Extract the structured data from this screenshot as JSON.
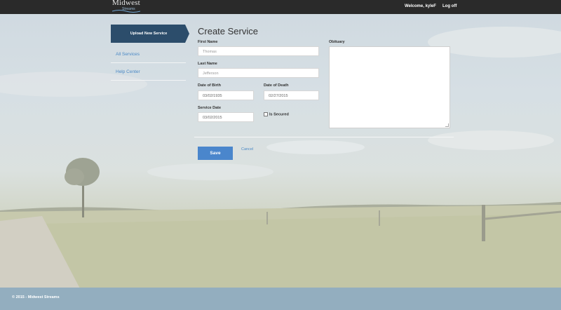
{
  "header": {
    "logo_text": "Midwest",
    "logo_subtext": "Streams",
    "welcome": "Welcome, kyleF",
    "logoff": "Log off"
  },
  "sidebar": {
    "items": [
      {
        "label": "Upload New Service",
        "active": true
      },
      {
        "label": "All Services",
        "active": false
      },
      {
        "label": "Help Center",
        "active": false
      }
    ]
  },
  "form": {
    "title": "Create Service",
    "first_name_label": "First Name",
    "first_name_value": "",
    "first_name_placeholder": "Thomas",
    "last_name_label": "Last Name",
    "last_name_value": "",
    "last_name_placeholder": "Jefferson",
    "dob_label": "Date of Birth",
    "dob_value": "03/02/1935",
    "dod_label": "Date of Death",
    "dod_value": "02/27/2015",
    "service_date_label": "Service Date",
    "service_date_value": "03/02/2015",
    "is_secured_label": "Is Secured",
    "is_secured_checked": false,
    "obituary_label": "Obituary",
    "obituary_value": "",
    "save_label": "Save",
    "cancel_label": "Cancel"
  },
  "footer": {
    "text": "© 2015 - Midwest Streams"
  },
  "colors": {
    "topbar": "#2a2a2a",
    "sidebar_active": "#2c4d6b",
    "link": "#4a88c5",
    "save_button": "#4a86cc",
    "footer": "#93aebf"
  }
}
